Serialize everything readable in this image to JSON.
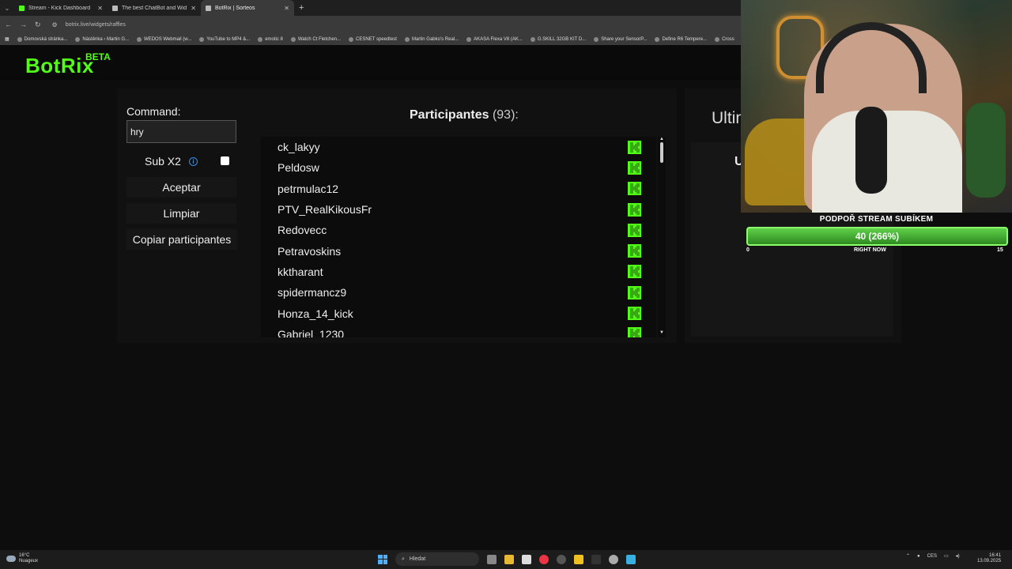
{
  "browser": {
    "tabs": [
      {
        "label": "Stream - Kick Dashboard",
        "color": "#53fc18",
        "active": false
      },
      {
        "label": "The best ChatBot and Widgets",
        "color": "#cccccc",
        "active": false
      },
      {
        "label": "BotRix | Sorteos",
        "color": "#cccccc",
        "active": true
      }
    ],
    "url": "botrix.live/widgets/raffles",
    "bookmarks": [
      "Domovská stránka...",
      "Nástěnka ‹ Martin G...",
      "WEDOS Webmail (w...",
      "YouTube to MP4 &...",
      "emotic 8",
      "Watch Ct Fletchen...",
      "CESNET speedtest",
      "Martin Gabko's Real...",
      "AKASA Flexa V8 (AK...",
      "G.SKILL 32GB KIT D...",
      "Share your SensorP...",
      "Define R6 Tempere...",
      "Cross"
    ]
  },
  "app": {
    "logo": "BotRix",
    "logo_badge": "BETA",
    "brand_color": "#53fc18"
  },
  "controls": {
    "command_label": "Command:",
    "command_value": "hry",
    "sub_label": "Sub X2",
    "sub_checked": false,
    "accept_label": "Aceptar",
    "clear_label": "Limpiar",
    "copy_label": "Copiar participantes"
  },
  "participants": {
    "title": "Participantes",
    "count": "(93):",
    "items": [
      "ck_lakyy",
      "Peldosw",
      "petrmulac12",
      "PTV_RealKikousFr",
      "Redovecc",
      "Petravoskins",
      "kktharant",
      "spidermancz9",
      "Honza_14_kick",
      "Gabriel_1230"
    ]
  },
  "right_panel": {
    "title_partial": "Ultim",
    "letter": "U"
  },
  "sub_goal": {
    "title": "PODPOŘ STREAM SUBÍKEM",
    "value": "40 (266%)",
    "min": "0",
    "center": "RIGHT NOW",
    "max": "15"
  },
  "taskbar": {
    "weather_temp": "16°C",
    "weather_desc": "Nuageux",
    "search_placeholder": "Hledat",
    "lang": "CES",
    "time": "16:41",
    "date": "13.09.2025"
  }
}
